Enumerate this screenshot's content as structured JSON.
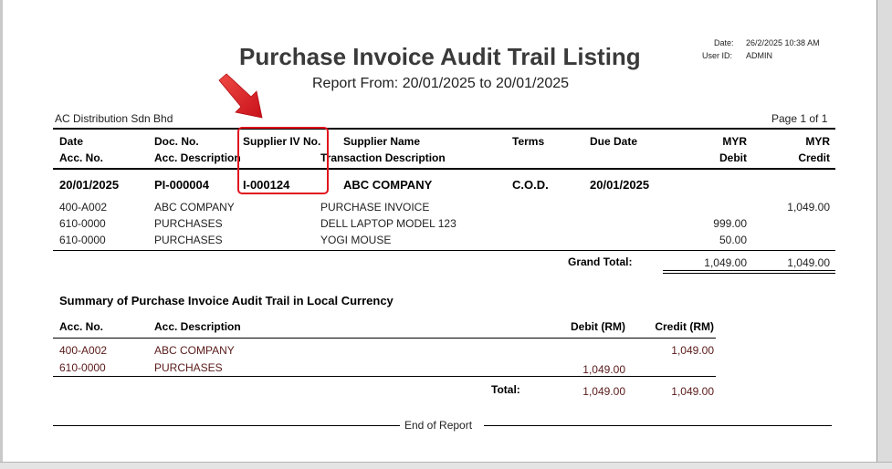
{
  "report": {
    "title": "Purchase Invoice Audit Trail Listing",
    "subtitle": "Report From: 20/01/2025 to 20/01/2025",
    "date_label": "Date:",
    "date_value": "26/2/2025 10:38 AM",
    "user_label": "User ID:",
    "user_value": "ADMIN",
    "company": "AC Distribution Sdn Bhd",
    "page": "Page 1 of 1"
  },
  "header": {
    "date": "Date",
    "doc_no": "Doc. No.",
    "supplier_iv_no": "Supplier IV No.",
    "supplier_name": "Supplier Name",
    "terms": "Terms",
    "due_date": "Due Date",
    "myr_debit_top": "MYR",
    "myr_credit_top": "MYR",
    "acc_no": "Acc. No.",
    "acc_desc": "Acc. Description",
    "trans_desc": "Transaction Description",
    "debit": "Debit",
    "credit": "Credit"
  },
  "invoice": {
    "date": "20/01/2025",
    "doc_no": "PI-000004",
    "supplier_iv_no": "I-000124",
    "supplier_name": "ABC COMPANY",
    "terms": "C.O.D.",
    "due_date": "20/01/2025",
    "lines": [
      {
        "acc_no": "400-A002",
        "acc_desc": "ABC COMPANY",
        "trans_desc": "PURCHASE INVOICE",
        "debit": "",
        "credit": "1,049.00"
      },
      {
        "acc_no": "610-0000",
        "acc_desc": "PURCHASES",
        "trans_desc": "DELL LAPTOP MODEL 123",
        "debit": "999.00",
        "credit": ""
      },
      {
        "acc_no": "610-0000",
        "acc_desc": "PURCHASES",
        "trans_desc": "YOGI MOUSE",
        "debit": "50.00",
        "credit": ""
      }
    ]
  },
  "grand_total": {
    "label": "Grand Total:",
    "debit": "1,049.00",
    "credit": "1,049.00"
  },
  "summary": {
    "title": "Summary of Purchase Invoice Audit Trail in Local Currency",
    "col_acc_no": "Acc. No.",
    "col_acc_desc": "Acc. Description",
    "col_debit": "Debit (RM)",
    "col_credit": "Credit (RM)",
    "rows": [
      {
        "acc_no": "400-A002",
        "acc_desc": "ABC COMPANY",
        "debit": "",
        "credit": "1,049.00"
      },
      {
        "acc_no": "610-0000",
        "acc_desc": "PURCHASES",
        "debit": "1,049.00",
        "credit": ""
      }
    ],
    "total_label": "Total:",
    "total_debit": "1,049.00",
    "total_credit": "1,049.00"
  },
  "footer": {
    "end_text": "End of Report"
  },
  "annotation": {
    "highlight_color": "#e0141e",
    "arrow_color": "#e0141e"
  }
}
